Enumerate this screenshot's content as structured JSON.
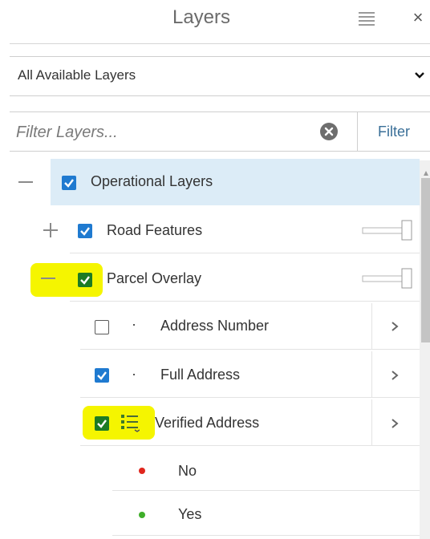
{
  "header": {
    "title": "Layers",
    "menu_icon": "hamburger-icon",
    "close_label": "×"
  },
  "layer_select": {
    "selected": "All Available Layers",
    "icon": "chevron-down-icon"
  },
  "filter": {
    "placeholder": "Filter Layers...",
    "clear_icon": "clear-x-circle-icon",
    "button_label": "Filter"
  },
  "tree": {
    "group": {
      "label": "Operational Layers",
      "checked": true,
      "expanded": true
    },
    "layers": [
      {
        "label": "Road Features",
        "checked": true,
        "expanded": false
      },
      {
        "label": "Parcel Overlay",
        "checked": true,
        "expanded": true
      }
    ],
    "sublayers": [
      {
        "label": "Address Number",
        "checked": false
      },
      {
        "label": "Full Address",
        "checked": true
      },
      {
        "label": "Verified Address",
        "checked": true
      }
    ],
    "legend": [
      {
        "label": "No",
        "color": "#e0261d"
      },
      {
        "label": "Yes",
        "color": "#3fae2a"
      }
    ]
  },
  "colors": {
    "accent": "#1f7ad0",
    "selected_row": "#dcecf7",
    "highlight": "#f5f500",
    "link": "#3a6f98"
  }
}
